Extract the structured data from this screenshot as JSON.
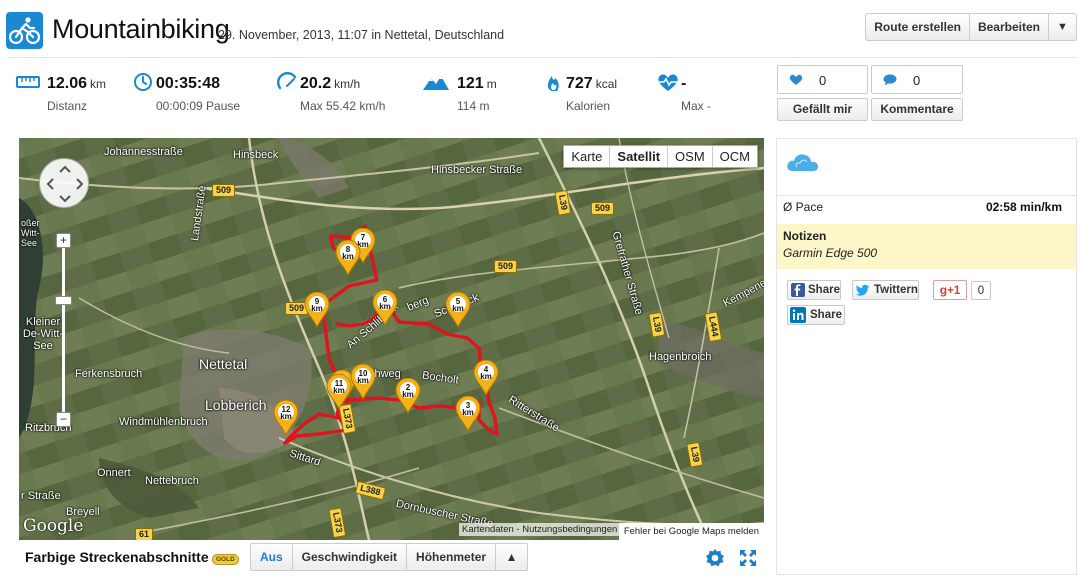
{
  "header": {
    "title": "Mountainbiking",
    "subtitle": "29. November, 2013, 11:07 in Nettetal, Deutschland",
    "buttons": {
      "create_route": "Route erstellen",
      "edit": "Bearbeiten",
      "more": "▼"
    }
  },
  "stats": [
    {
      "icon": "ruler-icon",
      "value": "12.06",
      "unit": "km",
      "sub": "Distanz"
    },
    {
      "icon": "clock-icon",
      "value": "00:35:48",
      "unit": "",
      "sub": "00:00:09 Pause"
    },
    {
      "icon": "speedometer-icon",
      "value": "20.2",
      "unit": "km/h",
      "sub": "Max 55.42 km/h"
    },
    {
      "icon": "mountain-icon",
      "value": "121",
      "unit": "m",
      "sub": "114 m"
    },
    {
      "icon": "flame-icon",
      "value": "727",
      "unit": "kcal",
      "sub": "Kalorien"
    },
    {
      "icon": "heartbeat-icon",
      "value": "-",
      "unit": "",
      "sub": "Max -"
    }
  ],
  "social": {
    "likes_count": "0",
    "comments_count": "0",
    "like_label": "Gefällt mir",
    "comment_label": "Kommentare"
  },
  "map": {
    "type_buttons": [
      "Karte",
      "Satellit",
      "OSM",
      "OCM"
    ],
    "active_type": "Satellit",
    "zoom_in": "+",
    "zoom_out": "−",
    "labels": {
      "johannesstrasse": "Johannesstraße",
      "hinsbeck": "Hinsbeck",
      "hinsbecker_strasse": "Hinsbecker Straße",
      "landstrasse": "Landstraße",
      "schlibeck": "Schlibeck",
      "an_schlibeck": "An Schlibeck",
      "berg": "berg",
      "nettetal": "Nettetal",
      "lobberich": "Lobberich",
      "ferkensbruch": "Ferkensbruch",
      "windmuehlenbruch": "Windmühlenbruch",
      "ritzbruch": "Ritzbruch",
      "kleiner_de_witt_see": "Kleiner De-Witt-See",
      "grosser_de_witt_see": "oßer Witt-See",
      "chweg": "chweg",
      "bocholt": "Bocholt",
      "ritterstrasse": "Ritterstraße",
      "sittard": "Sittard",
      "onnert": "Onnert",
      "nettebruch": "Nettebruch",
      "breyell": "Breyell",
      "dornbuscher_strasse": "Dornbuscher Straße",
      "strasse_left": "r Straße",
      "hagenbroich": "Hagenbroich",
      "grefrather_strasse": "Grefrather Straße",
      "kempener_strasse": "Kempener Straße"
    },
    "road_signs": {
      "r509a": "509",
      "r509b": "509",
      "r509c": "509",
      "l39a": "L39",
      "l39b": "L39",
      "l39c": "L39",
      "l373a": "L373",
      "l373b": "L373",
      "l388": "L388",
      "l444": "L444",
      "b61": "61"
    },
    "markers": [
      {
        "km": "1",
        "unit": "km"
      },
      {
        "km": "2",
        "unit": "km"
      },
      {
        "km": "3",
        "unit": "km"
      },
      {
        "km": "4",
        "unit": "km"
      },
      {
        "km": "5",
        "unit": "km"
      },
      {
        "km": "6",
        "unit": "km"
      },
      {
        "km": "7",
        "unit": "km"
      },
      {
        "km": "8",
        "unit": "km"
      },
      {
        "km": "9",
        "unit": "km"
      },
      {
        "km": "10",
        "unit": "km"
      },
      {
        "km": "11",
        "unit": "km"
      },
      {
        "km": "12",
        "unit": "km"
      }
    ],
    "google": "Google",
    "terms": "Kartendaten - Nutzungsbedingungen",
    "report_error": "Fehler bei Google Maps melden"
  },
  "bottom": {
    "title": "Farbige Streckenabschnitte",
    "badge": "GOLD",
    "segments": [
      "Aus",
      "Geschwindigkeit",
      "Höhenmeter",
      "▲"
    ],
    "active_segment": "Aus"
  },
  "panel": {
    "pace_label": "Ø Pace",
    "pace_value": "02:58 min/km",
    "notes_heading": "Notizen",
    "notes_text": "Garmin Edge 500",
    "share": {
      "facebook": "Share",
      "twitter": "Twittern",
      "gplus": "+1",
      "gplus_count": "0",
      "linkedin": "Share"
    }
  },
  "colors": {
    "accent": "#1b88d4",
    "route": "#e0141e",
    "marker": "#f3b21a",
    "notes_bg": "#fdf6c8"
  }
}
